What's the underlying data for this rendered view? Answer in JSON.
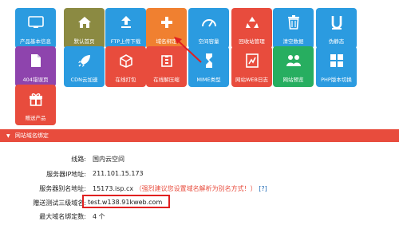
{
  "tiles": [
    {
      "label": "产品基本信息",
      "icon": "info-icon",
      "color": "#2b9be0"
    },
    {
      "label": "默认首页",
      "icon": "home-icon",
      "color": "#8b8a42"
    },
    {
      "label": "FTP上传下载",
      "icon": "upload-icon",
      "color": "#2b9be0"
    },
    {
      "label": "域名绑定",
      "icon": "plus-icon",
      "color": "#f08030"
    },
    {
      "label": "空间容量",
      "icon": "gauge-icon",
      "color": "#2b9be0"
    },
    {
      "label": "回收站管理",
      "icon": "recycle-icon",
      "color": "#e84c3d"
    },
    {
      "label": "清空数据",
      "icon": "trash-icon",
      "color": "#2b9be0"
    },
    {
      "label": "伪静态",
      "icon": "u-letter-icon",
      "color": "#2b9be0"
    },
    {
      "label": "404错误页",
      "icon": "document-icon",
      "color": "#8e44ad"
    },
    {
      "label": "CDN云加速",
      "icon": "rocket-icon",
      "color": "#2b9be0"
    },
    {
      "label": "在线打包",
      "icon": "package-icon",
      "color": "#e84c3d"
    },
    {
      "label": "在线解压缩",
      "icon": "unzip-icon",
      "color": "#e84c3d"
    },
    {
      "label": "MIME类型",
      "icon": "mime-icon",
      "color": "#2b9be0"
    },
    {
      "label": "网站WEB日志",
      "icon": "log-icon",
      "color": "#e84c3d"
    },
    {
      "label": "网站预览",
      "icon": "preview-icon",
      "color": "#27ae60"
    },
    {
      "label": "PHP版本切换",
      "icon": "switch-icon",
      "color": "#2b9be0"
    },
    {
      "label": "赠送产品",
      "icon": "gift-icon",
      "color": "#e84c3d"
    }
  ],
  "section": {
    "title": "网站域名绑定"
  },
  "rows": [
    {
      "key": "线路:",
      "value": "国内云空间"
    },
    {
      "key": "服务器IP地址:",
      "value": "211.101.15.173"
    },
    {
      "key": "服务器别名地址:",
      "value": "15173.isp.cx",
      "hint": "（强烈建议您设置域名解析为别名方式！）",
      "extra": "[?]"
    },
    {
      "key": "赠送测试三级域名:",
      "value": "test.w138.91kweb.com"
    },
    {
      "key": "最大域名绑定数:",
      "value": "4 个"
    }
  ],
  "colors": {
    "accent": "#e84c3d",
    "tile_blue": "#2b9be0",
    "highlight_box": "#e02020"
  }
}
